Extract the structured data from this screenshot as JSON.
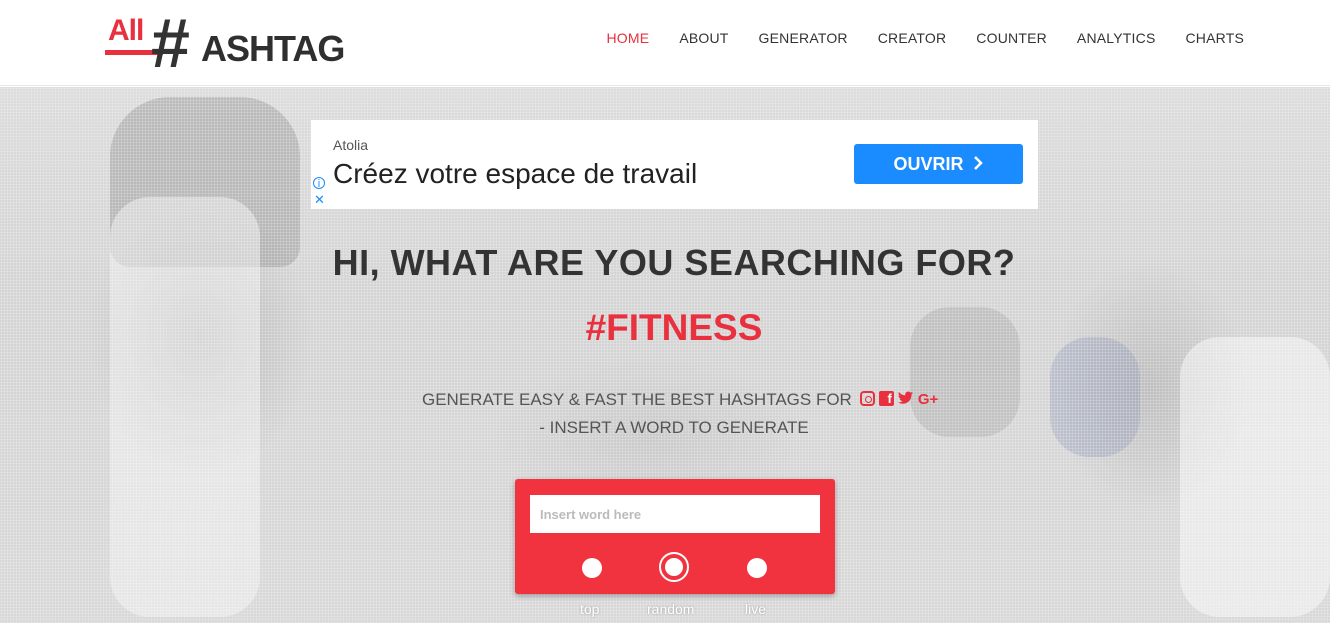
{
  "header": {
    "logo": {
      "all": "All",
      "hash": "#",
      "word": "ASHTAG"
    },
    "nav": [
      {
        "label": "HOME",
        "active": true
      },
      {
        "label": "ABOUT"
      },
      {
        "label": "GENERATOR"
      },
      {
        "label": "CREATOR"
      },
      {
        "label": "COUNTER"
      },
      {
        "label": "ANALYTICS"
      },
      {
        "label": "CHARTS"
      }
    ]
  },
  "ad": {
    "brand": "Atolia",
    "headline": "Créez votre espace de travail",
    "cta": "OUVRIR",
    "cta_icon": "chevron-right-icon",
    "info_icon": "info-icon",
    "close_icon": "close-icon"
  },
  "hero": {
    "title": "HI, WHAT ARE YOU SEARCHING FOR?",
    "hashtag": "#FITNESS",
    "subtitle_line1": "GENERATE EASY & FAST THE BEST HASHTAGS FOR",
    "subtitle_line2": "- INSERT A WORD TO GENERATE",
    "social_icons": [
      "instagram-icon",
      "facebook-icon",
      "twitter-icon",
      "google-plus-icon"
    ]
  },
  "search": {
    "placeholder": "Insert word here",
    "value": "",
    "modes": [
      {
        "label": "top",
        "selected": false
      },
      {
        "label": "random",
        "selected": true
      },
      {
        "label": "live",
        "selected": false
      }
    ]
  },
  "colors": {
    "accent": "#e8303e",
    "cta": "#1a8cff"
  }
}
